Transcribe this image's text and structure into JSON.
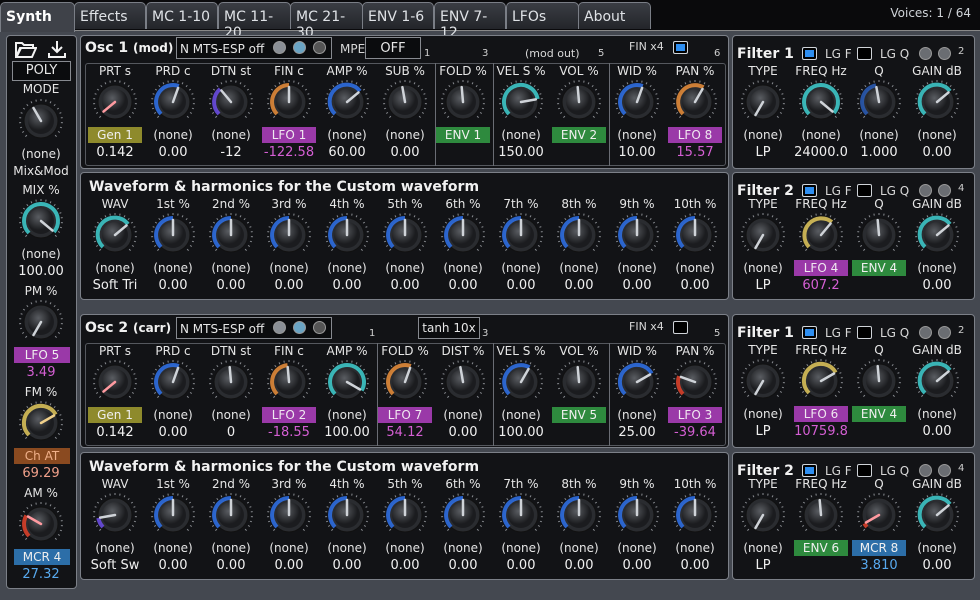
{
  "tabs": [
    {
      "label": "Synth"
    },
    {
      "label": "Effects"
    },
    {
      "label": "MC 1-10"
    },
    {
      "label": "MC 11-20"
    },
    {
      "label": "MC 21-30"
    },
    {
      "label": "ENV 1-6"
    },
    {
      "label": "ENV 7-12"
    },
    {
      "label": "LFOs"
    },
    {
      "label": "About"
    }
  ],
  "voices": "Voices: 1 / 64",
  "colors": {
    "lfo": "#9a39a8",
    "env": "#2e8a3e",
    "mcr": "#2c6ea8",
    "gen": "#8e8a2c",
    "chat": "#8a4a20",
    "knob_blue": "#2f6ee0",
    "knob_cyan": "#3ec6c8",
    "knob_orange": "#e08a3a",
    "knob_yellow": "#d8c05a",
    "knob_violet": "#6a4ce0",
    "knob_red": "#d8402a"
  },
  "sidebar": {
    "poly": "POLY",
    "mode_label": "MODE",
    "mode_mod": "(none)",
    "mixmod_label": "Mix&Mod",
    "mix_label": "MIX %",
    "mix_mod": "(none)",
    "mix_val": "100.00",
    "pm_label": "PM %",
    "pm_mod": "LFO 5",
    "pm_val": "3.49",
    "fm_label": "FM %",
    "fm_mod": "Ch AT",
    "fm_val": "69.29",
    "am_label": "AM %",
    "am_mod": "MCR 4",
    "am_val": "27.32"
  },
  "osc1": {
    "title": "Osc 1",
    "sub": "(mod)",
    "tuning": "N MTS-ESP off",
    "mpe": "MPE",
    "mpe_val": "OFF",
    "mod_out": "(mod out)",
    "fin": "FIN x4",
    "n1": "1",
    "n3": "3",
    "n5": "5",
    "n6": "6",
    "knobs": [
      {
        "label": "PRT s",
        "mod": "Gen 1",
        "val": "0.142"
      },
      {
        "label": "PRD c",
        "mod": "(none)",
        "val": "0.00"
      },
      {
        "label": "DTN st",
        "mod": "(none)",
        "val": "-12"
      },
      {
        "label": "FIN c",
        "mod": "LFO 1",
        "val": "-122.58"
      },
      {
        "label": "AMP %",
        "mod": "(none)",
        "val": "60.00"
      },
      {
        "label": "SUB %",
        "mod": "(none)",
        "val": "0.00"
      },
      {
        "label": "FOLD %",
        "mod": "ENV 1",
        "val": ""
      },
      {
        "label": "VEL S %",
        "mod": "(none)",
        "val": "150.00"
      },
      {
        "label": "VOL %",
        "mod": "ENV 2",
        "val": ""
      },
      {
        "label": "WID %",
        "mod": "(none)",
        "val": "10.00"
      },
      {
        "label": "PAN %",
        "mod": "LFO 8",
        "val": "15.57"
      }
    ]
  },
  "wave1": {
    "title": "Waveform & harmonics for the Custom waveform",
    "knobs": [
      {
        "label": "WAV",
        "mod": "(none)",
        "val": "Soft Tri"
      },
      {
        "label": "1st %",
        "mod": "(none)",
        "val": "0.00"
      },
      {
        "label": "2nd %",
        "mod": "(none)",
        "val": "0.00"
      },
      {
        "label": "3rd %",
        "mod": "(none)",
        "val": "0.00"
      },
      {
        "label": "4th %",
        "mod": "(none)",
        "val": "0.00"
      },
      {
        "label": "5th %",
        "mod": "(none)",
        "val": "0.00"
      },
      {
        "label": "6th %",
        "mod": "(none)",
        "val": "0.00"
      },
      {
        "label": "7th %",
        "mod": "(none)",
        "val": "0.00"
      },
      {
        "label": "8th %",
        "mod": "(none)",
        "val": "0.00"
      },
      {
        "label": "9th %",
        "mod": "(none)",
        "val": "0.00"
      },
      {
        "label": "10th %",
        "mod": "(none)",
        "val": "0.00"
      }
    ]
  },
  "osc2": {
    "title": "Osc 2",
    "sub": "(carr)",
    "tuning": "N MTS-ESP off",
    "shaper": "tanh 10x",
    "fin": "FIN x4",
    "n1": "1",
    "n3": "3",
    "n5": "5",
    "knobs": [
      {
        "label": "PRT s",
        "mod": "Gen 1",
        "val": "0.142"
      },
      {
        "label": "PRD c",
        "mod": "(none)",
        "val": "0.00"
      },
      {
        "label": "DTN st",
        "mod": "(none)",
        "val": "0"
      },
      {
        "label": "FIN c",
        "mod": "LFO 2",
        "val": "-18.55"
      },
      {
        "label": "AMP %",
        "mod": "(none)",
        "val": "100.00"
      },
      {
        "label": "FOLD %",
        "mod": "LFO 7",
        "val": "54.12"
      },
      {
        "label": "DIST %",
        "mod": "(none)",
        "val": "0.00"
      },
      {
        "label": "VEL S %",
        "mod": "(none)",
        "val": "100.00"
      },
      {
        "label": "VOL %",
        "mod": "ENV 5",
        "val": ""
      },
      {
        "label": "WID %",
        "mod": "(none)",
        "val": "25.00"
      },
      {
        "label": "PAN %",
        "mod": "LFO 3",
        "val": "-39.64"
      }
    ]
  },
  "wave2": {
    "title": "Waveform & harmonics for the Custom waveform",
    "knobs": [
      {
        "label": "WAV",
        "mod": "(none)",
        "val": "Soft Sw"
      },
      {
        "label": "1st %",
        "mod": "(none)",
        "val": "0.00"
      },
      {
        "label": "2nd %",
        "mod": "(none)",
        "val": "0.00"
      },
      {
        "label": "3rd %",
        "mod": "(none)",
        "val": "0.00"
      },
      {
        "label": "4th %",
        "mod": "(none)",
        "val": "0.00"
      },
      {
        "label": "5th %",
        "mod": "(none)",
        "val": "0.00"
      },
      {
        "label": "6th %",
        "mod": "(none)",
        "val": "0.00"
      },
      {
        "label": "7th %",
        "mod": "(none)",
        "val": "0.00"
      },
      {
        "label": "8th %",
        "mod": "(none)",
        "val": "0.00"
      },
      {
        "label": "9th %",
        "mod": "(none)",
        "val": "0.00"
      },
      {
        "label": "10th %",
        "mod": "(none)",
        "val": "0.00"
      }
    ]
  },
  "filters": [
    {
      "title": "Filter 1",
      "lgf": "LG F",
      "lgq": "LG Q",
      "num": "2",
      "knobs": [
        {
          "label": "TYPE",
          "mod": "(none)",
          "val": "LP"
        },
        {
          "label": "FREQ Hz",
          "mod": "(none)",
          "val": "24000.0"
        },
        {
          "label": "Q",
          "mod": "(none)",
          "val": "1.000"
        },
        {
          "label": "GAIN dB",
          "mod": "(none)",
          "val": "0.00"
        }
      ]
    },
    {
      "title": "Filter 2",
      "lgf": "LG F",
      "lgq": "LG Q",
      "num": "4",
      "knobs": [
        {
          "label": "TYPE",
          "mod": "(none)",
          "val": "LP"
        },
        {
          "label": "FREQ Hz",
          "mod": "LFO 4",
          "val": "607.2"
        },
        {
          "label": "Q",
          "mod": "ENV 4",
          "val": ""
        },
        {
          "label": "GAIN dB",
          "mod": "(none)",
          "val": "0.00"
        }
      ]
    },
    {
      "title": "Filter 1",
      "lgf": "LG F",
      "lgq": "LG Q",
      "num": "2",
      "knobs": [
        {
          "label": "TYPE",
          "mod": "(none)",
          "val": "LP"
        },
        {
          "label": "FREQ Hz",
          "mod": "LFO 6",
          "val": "10759.8"
        },
        {
          "label": "Q",
          "mod": "ENV 4",
          "val": ""
        },
        {
          "label": "GAIN dB",
          "mod": "(none)",
          "val": "0.00"
        }
      ]
    },
    {
      "title": "Filter 2",
      "lgf": "LG F",
      "lgq": "LG Q",
      "num": "4",
      "knobs": [
        {
          "label": "TYPE",
          "mod": "(none)",
          "val": "LP"
        },
        {
          "label": "FREQ Hz",
          "mod": "ENV 6",
          "val": ""
        },
        {
          "label": "Q",
          "mod": "MCR 8",
          "val": "3.810"
        },
        {
          "label": "GAIN dB",
          "mod": "(none)",
          "val": "0.00"
        }
      ]
    }
  ]
}
